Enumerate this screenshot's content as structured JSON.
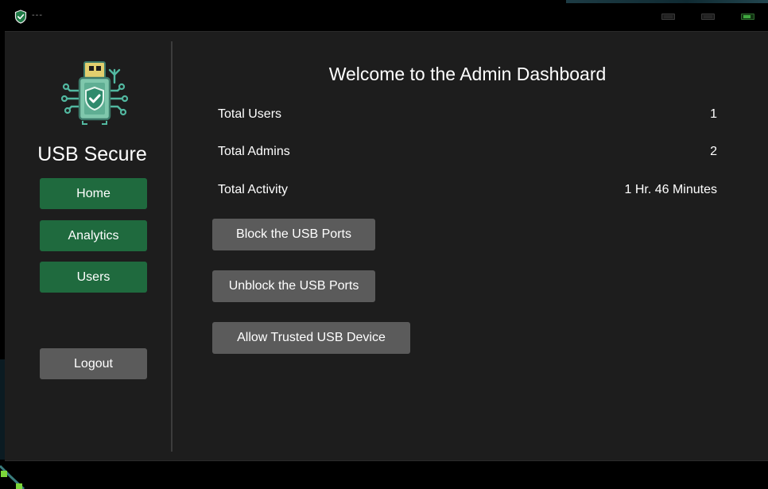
{
  "titlebar": {
    "title": "---",
    "icon": "shield-check-icon",
    "controls": [
      "minimize-icon",
      "maximize-icon",
      "close-icon"
    ]
  },
  "sidebar": {
    "logo_icon": "usb-shield-circuit-icon",
    "brand": "USB Secure",
    "nav": {
      "home": "Home",
      "analytics": "Analytics",
      "users": "Users"
    },
    "logout": "Logout"
  },
  "main": {
    "heading": "Welcome to the Admin Dashboard",
    "stats": [
      {
        "label": "Total Users",
        "value": "1"
      },
      {
        "label": "Total Admins",
        "value": "2"
      },
      {
        "label": "Total Activity",
        "value": "1 Hr. 46 Minutes"
      }
    ],
    "actions": {
      "block": "Block the USB Ports",
      "unblock": "Unblock the USB Ports",
      "trusted": "Allow Trusted USB Device"
    }
  },
  "colors": {
    "background": "#1d1d1d",
    "titlebar": "#000000",
    "nav_button": "#1f6a3e",
    "neutral_button": "#5b5b5b",
    "accent": "#3fa83f",
    "text": "#ffffff"
  }
}
